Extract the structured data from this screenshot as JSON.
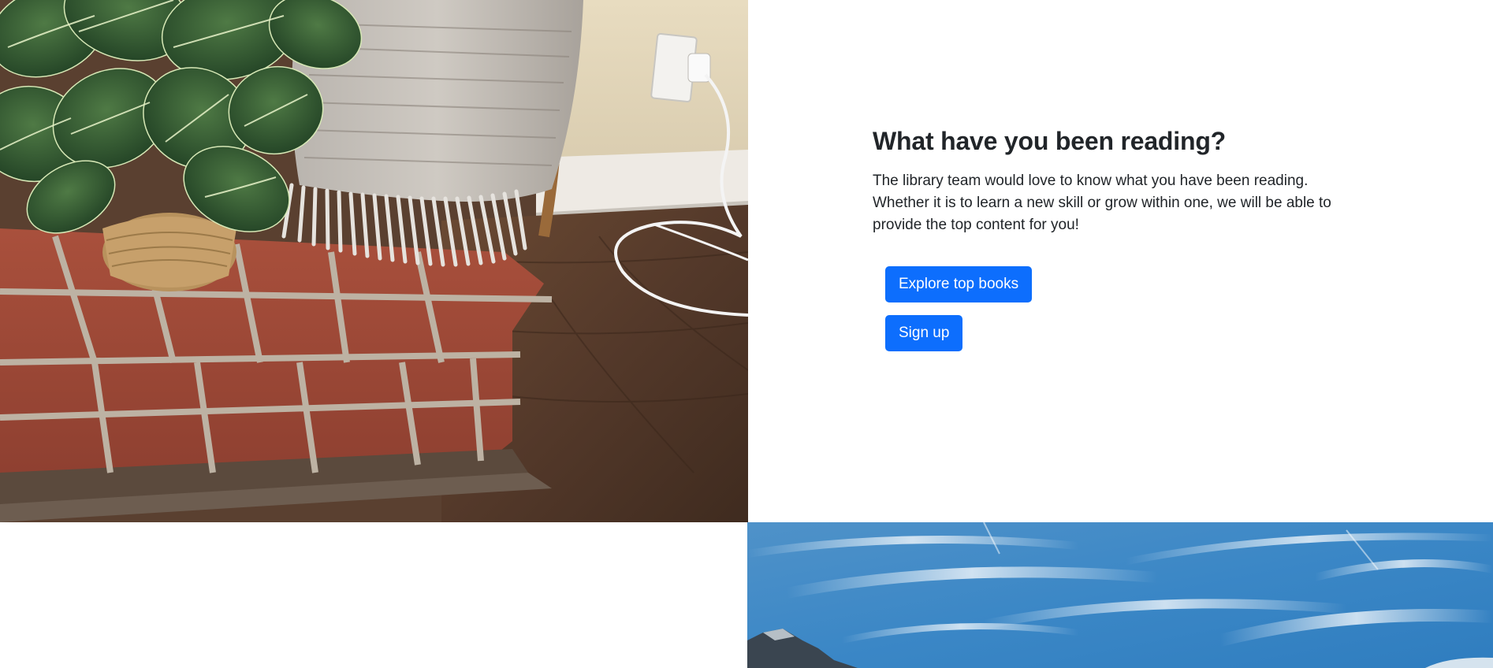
{
  "feature": {
    "heading": "What have you been reading?",
    "body": "The library team would love to know what you have been reading. Whether it is to learn a new skill or grow within one, we will be able to provide the top content for you!",
    "buttons": {
      "explore_label": "Explore top books",
      "signup_label": "Sign up"
    }
  },
  "colors": {
    "primary_button": "#0d6efd",
    "heading_text": "#212529",
    "page_background": "#ffffff"
  },
  "images": {
    "top_photo": "photo of a potted plant and woven throw blanket on a brick hearth",
    "bottom_photo": "photo of a blue sky with wispy clouds above a mountain"
  }
}
